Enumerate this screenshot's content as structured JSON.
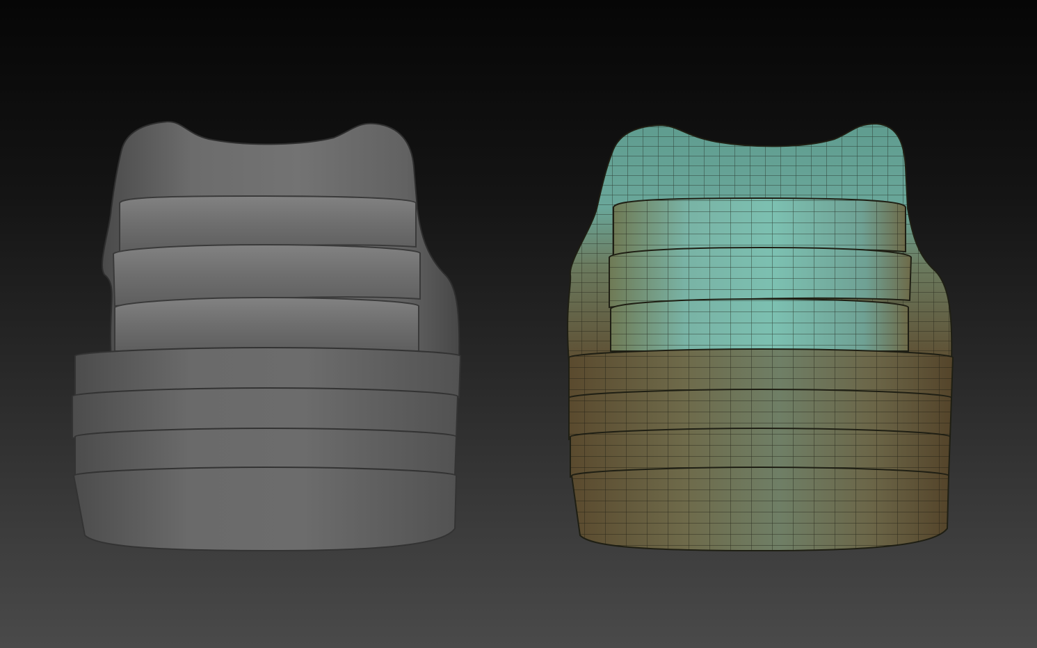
{
  "scene": {
    "background_top": "#060606",
    "background_bottom": "#4a4a4a",
    "models": [
      {
        "id": "sculpt",
        "shading": "matcap-gray",
        "color": "#6e6e6e",
        "upper_plates": 3,
        "lower_bands": 4,
        "wireframe": false
      },
      {
        "id": "retopo",
        "shading": "polygroup-wireframe",
        "color_top": "#66a89a",
        "color_bottom": "#6e5a36",
        "upper_plates": 3,
        "lower_bands": 4,
        "wireframe": true,
        "wire_color": "#1a1a12"
      }
    ]
  }
}
